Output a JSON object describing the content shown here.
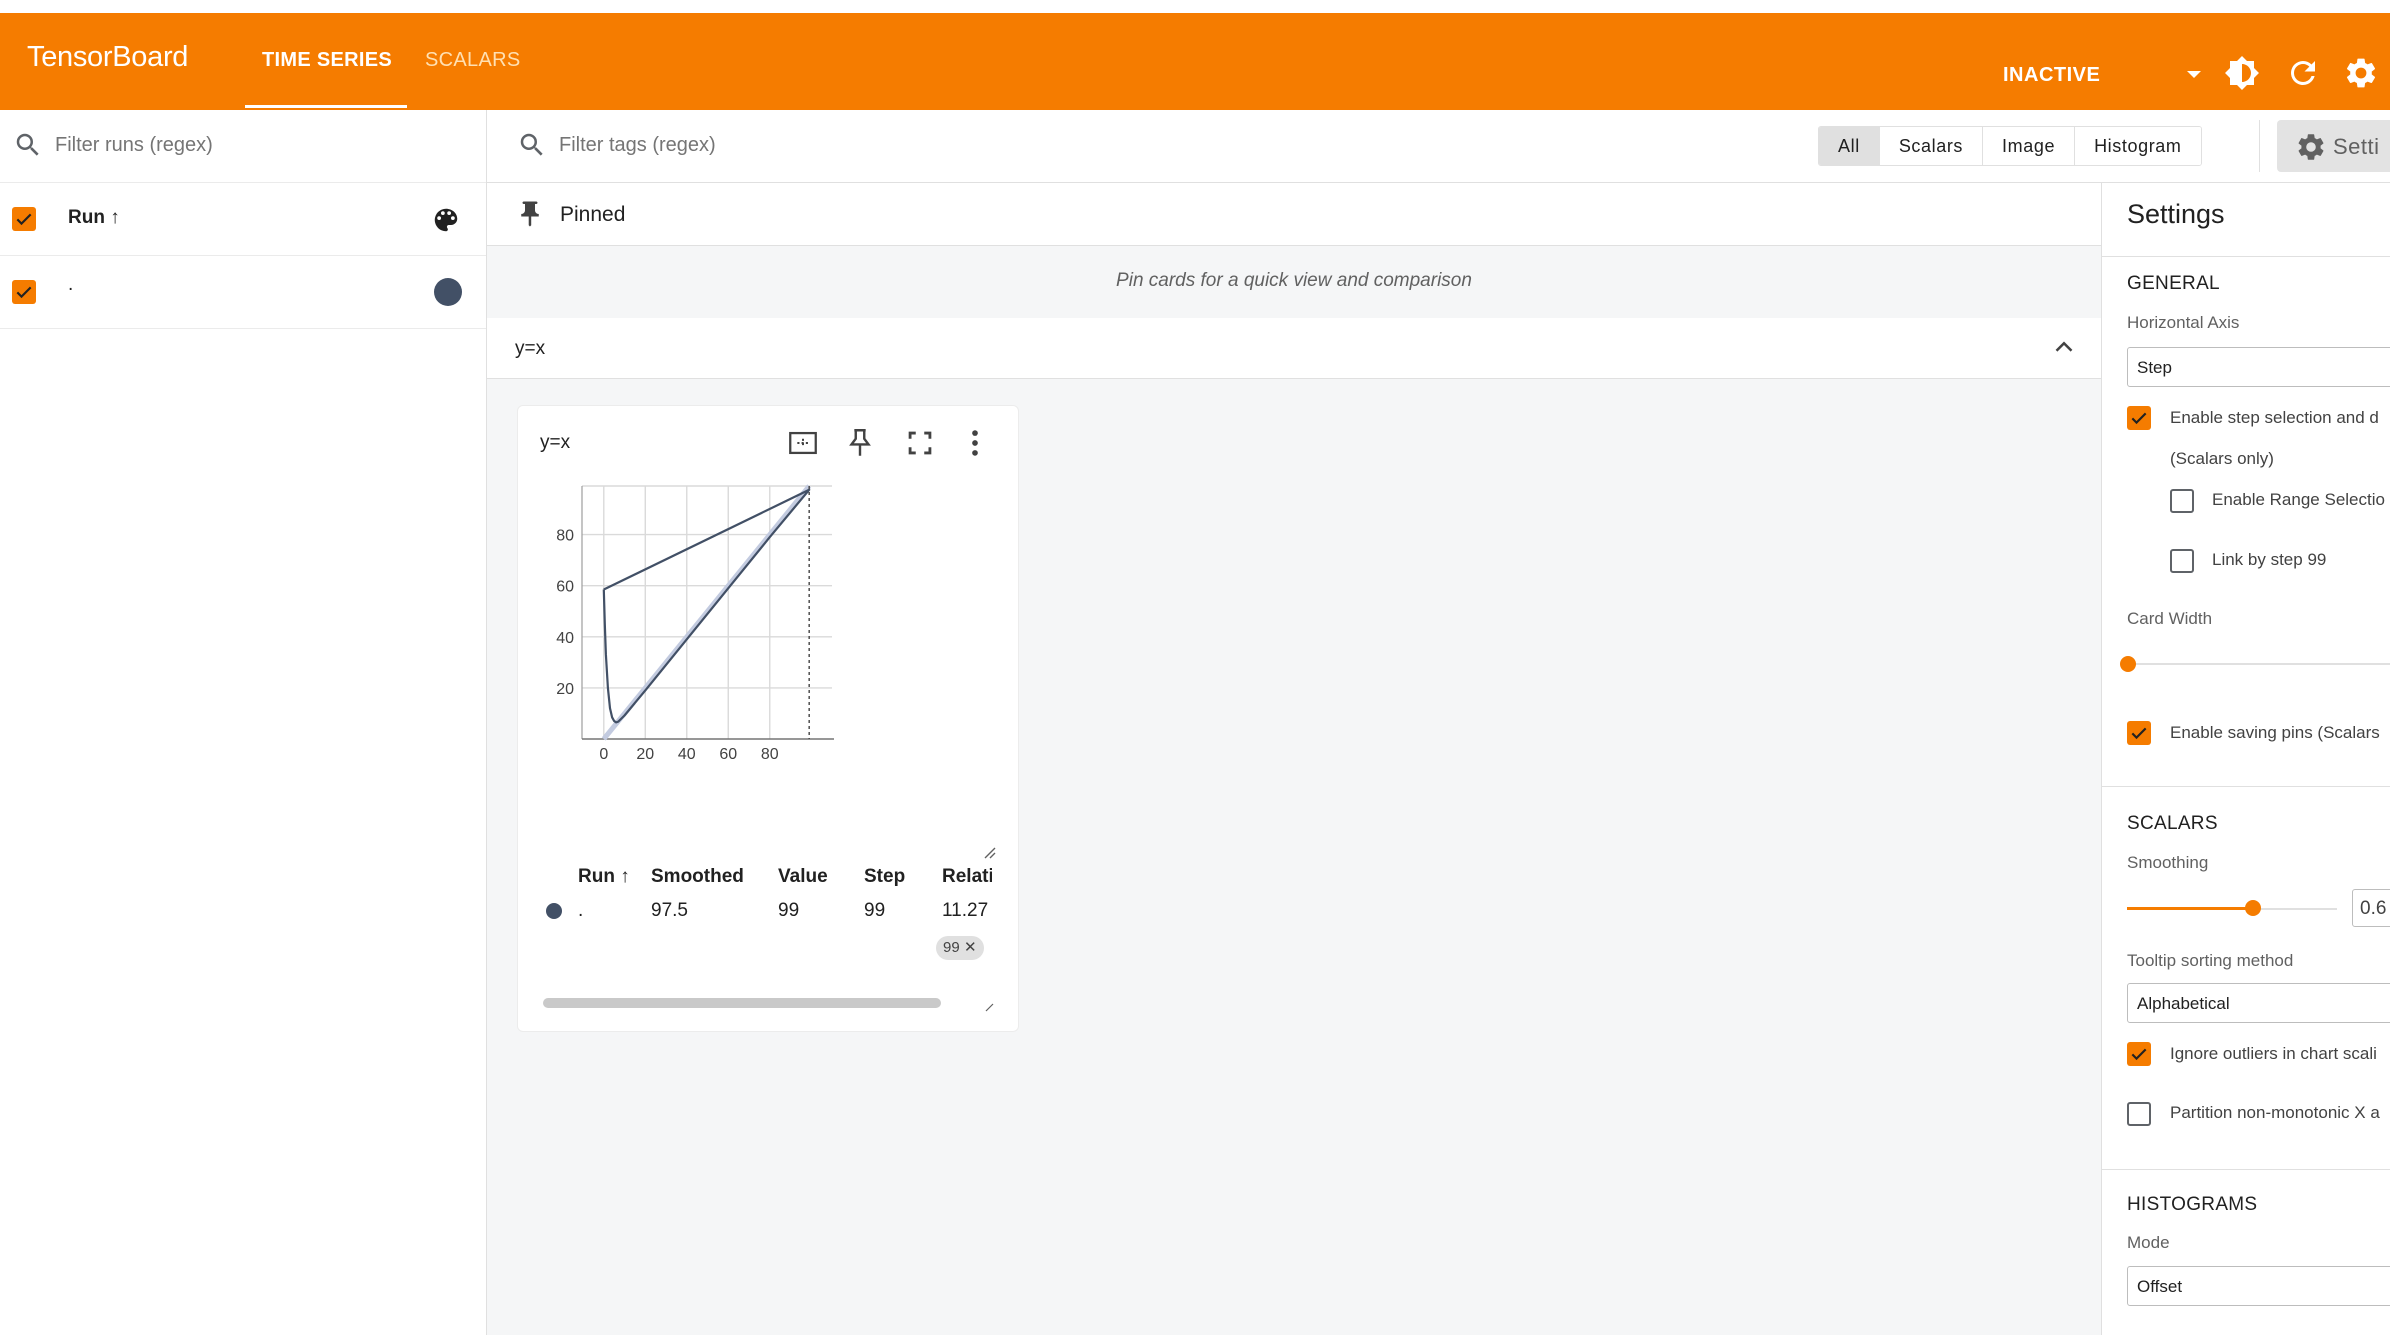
{
  "app": {
    "name": "TensorBoard",
    "tabs": [
      {
        "label": "TIME SERIES",
        "active": true
      },
      {
        "label": "SCALARS",
        "active": false
      }
    ],
    "run_status": "INACTIVE",
    "brand_color": "#f57c00"
  },
  "runs_panel": {
    "filter_placeholder": "Filter runs (regex)",
    "header_label": "Run ↑",
    "runs": [
      {
        "name": ".",
        "checked": true,
        "color": "#425066"
      }
    ]
  },
  "toolbar": {
    "filter_placeholder": "Filter tags (regex)",
    "type_buttons": [
      {
        "label": "All",
        "selected": true
      },
      {
        "label": "Scalars",
        "selected": false
      },
      {
        "label": "Image",
        "selected": false
      },
      {
        "label": "Histogram",
        "selected": false
      }
    ],
    "settings_label": "Setti"
  },
  "pinned": {
    "title": "Pinned",
    "empty_message": "Pin cards for a quick view and comparison"
  },
  "group": {
    "title": "y=x",
    "expanded": true
  },
  "card": {
    "title": "y=x",
    "step_chip": "99",
    "table": {
      "columns": [
        "Run ↑",
        "Smoothed",
        "Value",
        "Step",
        "Relati"
      ],
      "rows": [
        {
          "run": ".",
          "smoothed": "97.5",
          "value": "99",
          "step": "99",
          "relative": "11.27"
        }
      ]
    }
  },
  "chart_data": {
    "type": "line",
    "title": "y=x",
    "xlabel": "",
    "ylabel": "",
    "xlim": [
      -10.5,
      110
    ],
    "ylim": [
      0,
      99
    ],
    "x_ticks": [
      0,
      20,
      40,
      60,
      80
    ],
    "y_ticks": [
      20,
      40,
      60,
      80
    ],
    "grid": true,
    "selected_step": 99,
    "series": [
      {
        "name": ".",
        "style": "raw",
        "color": "#c3cbe0",
        "points": [
          [
            0,
            0
          ],
          [
            20,
            20
          ],
          [
            40,
            40
          ],
          [
            60,
            60
          ],
          [
            80,
            80
          ],
          [
            99,
            99
          ]
        ]
      },
      {
        "name": ".",
        "style": "smoothed",
        "color": "#425066",
        "points": [
          [
            0,
            58.5
          ],
          [
            0.5,
            45
          ],
          [
            1,
            33
          ],
          [
            2,
            20
          ],
          [
            3,
            12
          ],
          [
            4,
            8.5
          ],
          [
            5,
            7
          ],
          [
            6,
            6.5
          ],
          [
            7,
            6.8
          ],
          [
            10,
            9.2
          ],
          [
            20,
            19
          ],
          [
            40,
            39
          ],
          [
            60,
            59
          ],
          [
            80,
            79
          ],
          [
            99,
            97.5
          ],
          [
            0,
            58.5
          ]
        ]
      }
    ]
  },
  "settings": {
    "title": "Settings",
    "general": {
      "header": "GENERAL",
      "horizontal_axis_label": "Horizontal Axis",
      "horizontal_axis_value": "Step",
      "step_selection_label": "Enable step selection and d",
      "step_selection_sub": "(Scalars only)",
      "step_selection_checked": true,
      "range_selection_label": "Enable Range Selectio",
      "range_selection_checked": false,
      "link_step_label": "Link by step 99",
      "link_step_checked": false,
      "card_width_label": "Card Width",
      "card_width_level": 0,
      "saving_pins_label": "Enable saving pins (Scalars",
      "saving_pins_checked": true
    },
    "scalars": {
      "header": "SCALARS",
      "smoothing_label": "Smoothing",
      "smoothing_value": "0.6",
      "tooltip_sort_label": "Tooltip sorting method",
      "tooltip_sort_value": "Alphabetical",
      "ignore_outliers_label": "Ignore outliers in chart scali",
      "ignore_outliers_checked": true,
      "partition_label": "Partition non-monotonic X a",
      "partition_checked": false
    },
    "histograms": {
      "header": "HISTOGRAMS",
      "mode_label": "Mode",
      "mode_value": "Offset"
    }
  }
}
